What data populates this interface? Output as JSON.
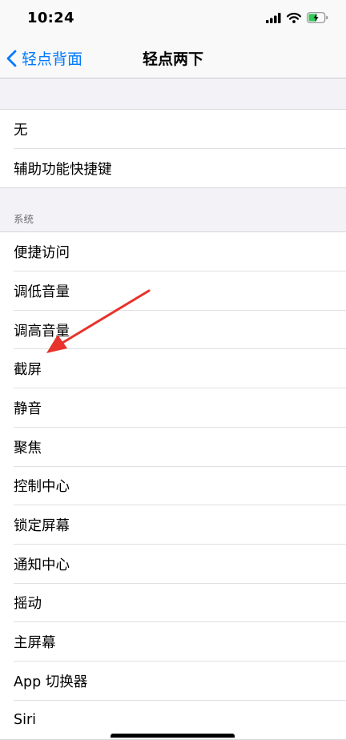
{
  "status_bar": {
    "time": "10:24",
    "icons": [
      "signal-icon",
      "wifi-icon",
      "battery-charging-icon"
    ]
  },
  "nav": {
    "back_label": "轻点背面",
    "title": "轻点两下"
  },
  "group1": {
    "items": [
      {
        "label": "无"
      },
      {
        "label": "辅助功能快捷键"
      }
    ]
  },
  "system": {
    "header": "系统",
    "items": [
      {
        "label": "便捷访问"
      },
      {
        "label": "调低音量"
      },
      {
        "label": "调高音量"
      },
      {
        "label": "截屏"
      },
      {
        "label": "静音"
      },
      {
        "label": "聚焦"
      },
      {
        "label": "控制中心"
      },
      {
        "label": "锁定屏幕"
      },
      {
        "label": "通知中心"
      },
      {
        "label": "摇动"
      },
      {
        "label": "主屏幕"
      },
      {
        "label": "App 切换器"
      },
      {
        "label": "Siri"
      }
    ]
  },
  "colors": {
    "accent": "#007aff",
    "annotation_arrow": "#e8322c",
    "background": "#f2f2f7"
  }
}
